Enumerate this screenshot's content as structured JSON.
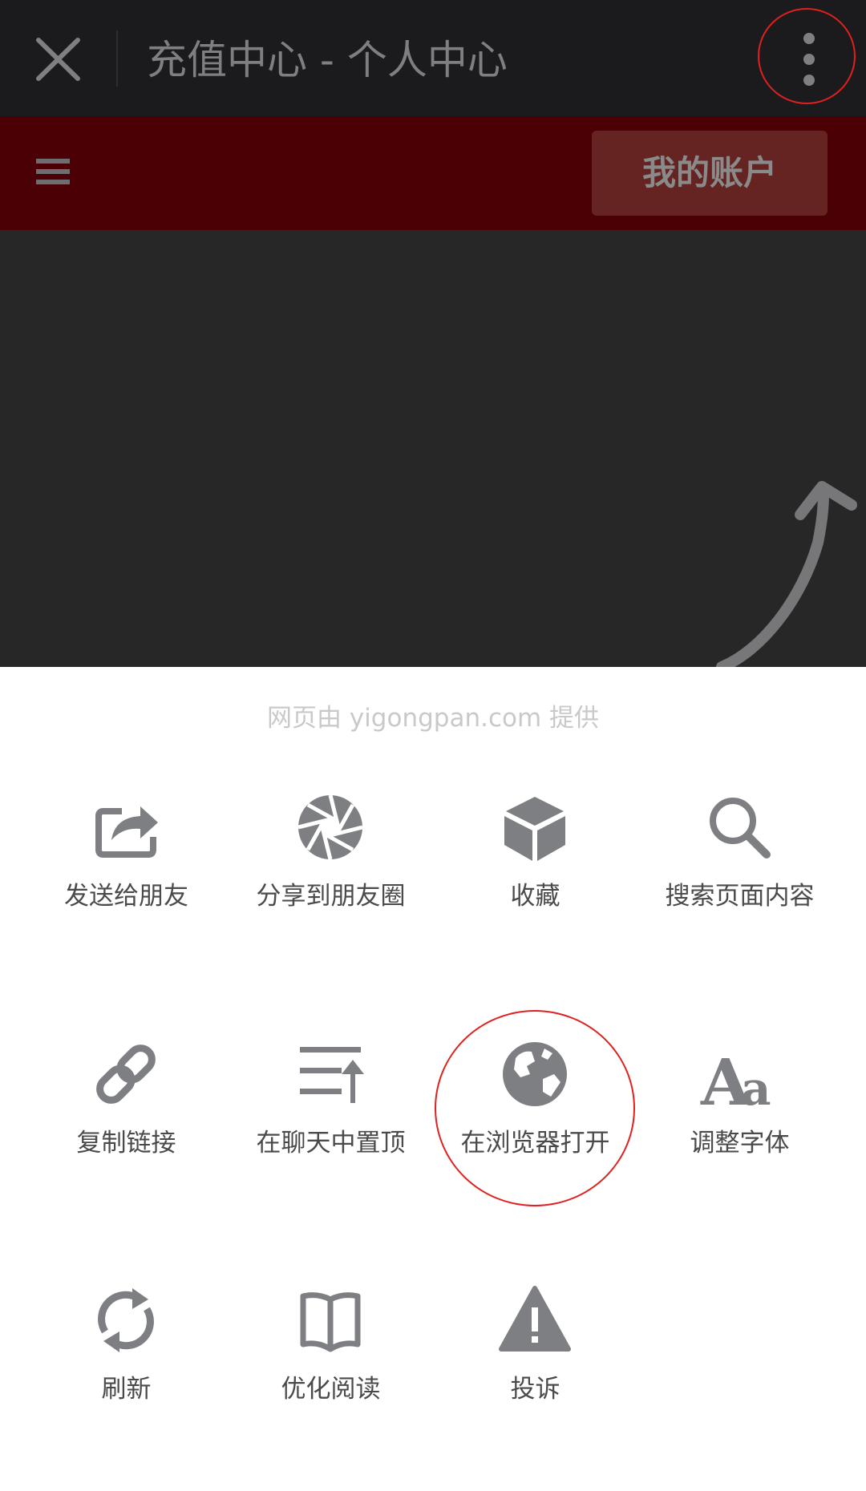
{
  "window": {
    "title": "充值中心 - 个人中心",
    "close_icon": "close-icon",
    "more_icon": "more-vertical-icon"
  },
  "site_header": {
    "menu_icon": "hamburger-menu-icon",
    "account_button": "我的账户",
    "brand_color": "#4a0005"
  },
  "sheet": {
    "provider_note": "网页由 yigongpan.com 提供",
    "rows": [
      [
        {
          "label": "发送给朋友",
          "icon": "share-forward-icon"
        },
        {
          "label": "分享到朋友圈",
          "icon": "moments-aperture-icon"
        },
        {
          "label": "收藏",
          "icon": "favorite-cube-icon"
        },
        {
          "label": "搜索页面内容",
          "icon": "search-icon"
        }
      ],
      [
        {
          "label": "复制链接",
          "icon": "link-icon"
        },
        {
          "label": "在聊天中置顶",
          "icon": "pin-to-top-icon"
        },
        {
          "label": "在浏览器打开",
          "icon": "globe-icon"
        },
        {
          "label": "调整字体",
          "icon": "font-size-icon"
        }
      ],
      [
        {
          "label": "刷新",
          "icon": "refresh-icon"
        },
        {
          "label": "优化阅读",
          "icon": "reader-book-icon"
        },
        {
          "label": "投诉",
          "icon": "warning-icon"
        }
      ]
    ]
  },
  "colors": {
    "icon_gray": "#7d7f83",
    "highlight_red": "#e0201f",
    "topbar_bg": "#1b1b1d",
    "dim_bg": "#272727"
  }
}
